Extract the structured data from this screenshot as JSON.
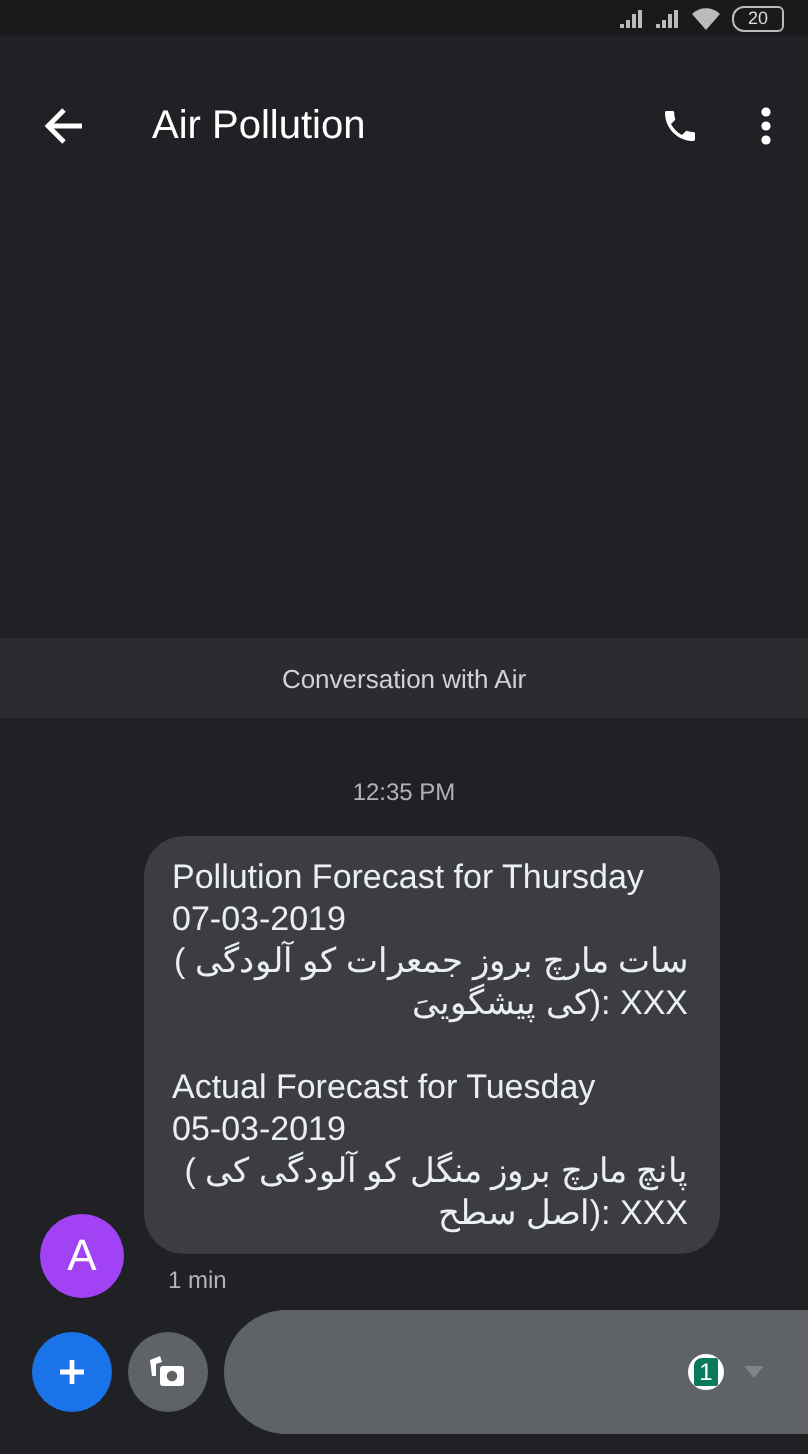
{
  "status_bar": {
    "battery": "20"
  },
  "app_bar": {
    "title": "Air Pollution"
  },
  "banner": {
    "text": "Conversation with Air"
  },
  "timestamp": "12:35 PM",
  "message": {
    "sender_initial": "A",
    "time": "1 min",
    "parts": [
      {
        "kind": "latin",
        "text": "Pollution Forecast for Thursday"
      },
      {
        "kind": "latin",
        "text": "07-03-2019"
      },
      {
        "kind": "urdu",
        "text": "( سات مارچ بروز جمعرات کو آلودگی کی پیشگوییَ): XXX"
      },
      {
        "kind": "gap"
      },
      {
        "kind": "latin",
        "text": "Actual Forecast for Tuesday"
      },
      {
        "kind": "latin",
        "text": "05-03-2019"
      },
      {
        "kind": "urdu",
        "text": "( پانچ مارچ بروز منگل کو آلودگی کی اصل سطح): XXX"
      }
    ]
  },
  "composer": {
    "sim": "1"
  }
}
